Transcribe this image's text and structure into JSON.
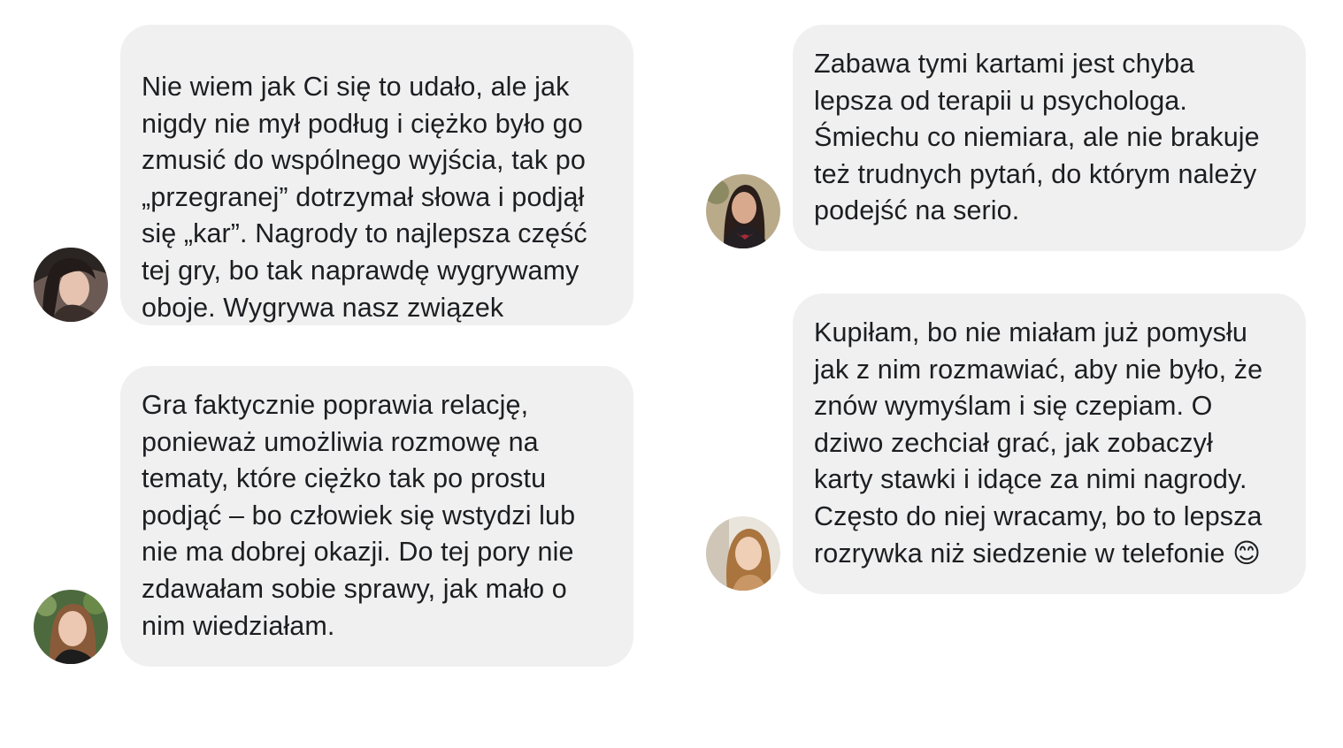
{
  "messages": [
    {
      "lines": [
        "Nie wiem jak Ci się to udało, ale jak",
        "nigdy nie mył podług i ciężko było go",
        "zmusić do wspólnego wyjścia, tak po",
        "„przegranej” dotrzymał słowa i podjął",
        "się „kar”. Nagrody to najlepsza część",
        "tej gry, bo tak naprawdę wygrywamy",
        "oboje. Wygrywa nasz związek"
      ]
    },
    {
      "lines": [
        "Gra faktycznie poprawia relację,",
        "ponieważ umożliwia rozmowę na",
        "tematy, które ciężko tak po prostu",
        "podjąć – bo człowiek się wstydzi lub",
        "nie ma dobrej okazji. Do tej pory nie",
        "zdawałam sobie sprawy, jak mało o",
        "nim wiedziałam."
      ]
    },
    {
      "lines": [
        "Zabawa tymi kartami jest chyba",
        "lepsza od terapii u psychologa.",
        "Śmiechu co niemiara, ale nie brakuje",
        "też trudnych pytań, do którym należy",
        "podejść na serio."
      ]
    },
    {
      "lines": [
        "Kupiłam, bo nie miałam już pomysłu",
        "jak z nim rozmawiać, aby nie było, że",
        "znów wymyślam i się czepiam. O",
        "dziwo zechciał grać, jak zobaczył",
        "karty stawki i idące za nimi nagrody.",
        "Często do niej wracamy, bo to lepsza",
        "rozrywka niż siedzenie w telefonie 😊"
      ]
    }
  ],
  "colors": {
    "bubble_background": "#f0f0f0",
    "text": "#1c1e21",
    "page_background": "#ffffff"
  },
  "icons": {
    "avatar": "user-photo-avatar",
    "emoji": "smiling-face-emoji"
  }
}
